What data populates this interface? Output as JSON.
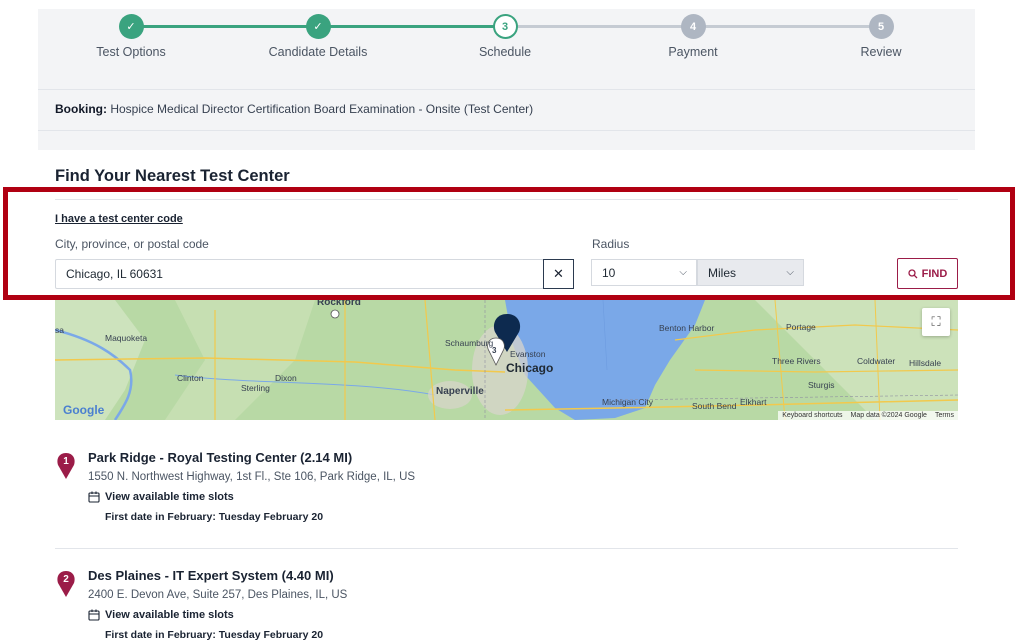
{
  "stepper": {
    "steps": [
      {
        "label": "Test Options",
        "marker": "✓"
      },
      {
        "label": "Candidate Details",
        "marker": "✓"
      },
      {
        "label": "Schedule",
        "marker": "3"
      },
      {
        "label": "Payment",
        "marker": "4"
      },
      {
        "label": "Review",
        "marker": "5"
      }
    ],
    "colors": {
      "done": "#3aa37f",
      "todo": "#aeb6c2"
    }
  },
  "booking": {
    "label": "Booking:",
    "value": "Hospice Medical Director Certification Board Examination - Onsite (Test Center)"
  },
  "finder": {
    "title": "Find Your Nearest Test Center",
    "code_link": "I have a test center code",
    "city_label": "City, province, or postal code",
    "city_value": "Chicago, IL 60631",
    "clear_icon": "✕",
    "radius_label": "Radius",
    "radius_value": "10",
    "unit_value": "Miles",
    "find_label": "FIND",
    "accent": "#9b1c48"
  },
  "map": {
    "labels": {
      "rockford": "Rockford",
      "maquoketa": "Maquoketa",
      "clinton": "Clinton",
      "sterling": "Sterling",
      "dixon": "Dixon",
      "schaumburg": "Schaumburg",
      "evanston": "Evanston",
      "chicago": "Chicago",
      "naperville": "Naperville",
      "benton_harbor": "Benton Harbor",
      "portage": "Portage",
      "three_rivers": "Three Rivers",
      "coldwater": "Coldwater",
      "hillsdale": "Hillsdale",
      "sturgis": "Sturgis",
      "michigan_city": "Michigan City",
      "south_bend": "South Bend",
      "elkhart": "Elkhart",
      "sa": "sa"
    },
    "cluster_count": "3",
    "google": "Google",
    "footer": {
      "shortcuts": "Keyboard shortcuts",
      "data": "Map data ©2024 Google",
      "terms": "Terms"
    },
    "fullscreen_icon": "⛶"
  },
  "results": [
    {
      "number": "1",
      "title": "Park Ridge - Royal Testing Center (2.14 MI)",
      "address": "1550 N. Northwest Highway, 1st Fl., Ste 106, Park Ridge, IL, US",
      "slots_label": "View available time slots",
      "first_date": "First date in February: Tuesday February 20"
    },
    {
      "number": "2",
      "title": "Des Plaines - IT Expert System (4.40 MI)",
      "address": "2400 E. Devon Ave, Suite 257, Des Plaines, IL, US",
      "slots_label": "View available time slots",
      "first_date": "First date in February: Tuesday February 20"
    }
  ]
}
